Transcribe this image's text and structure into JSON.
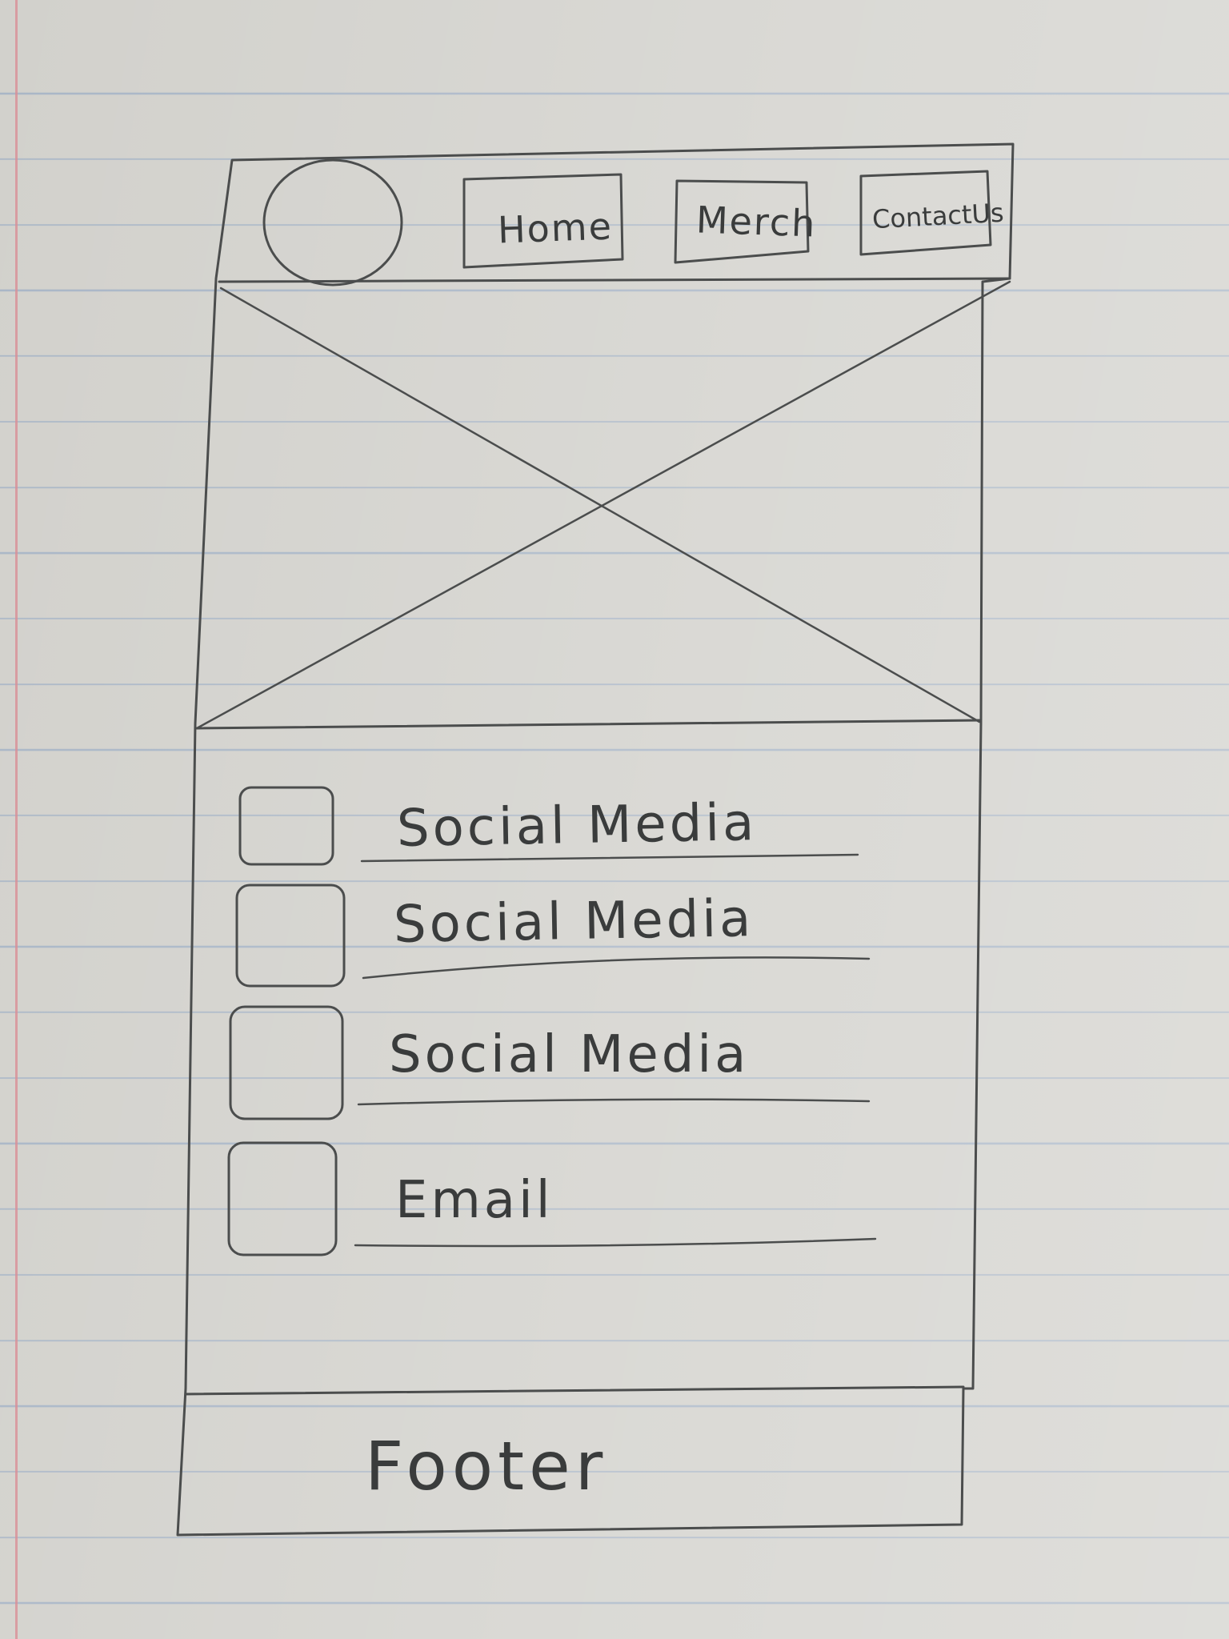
{
  "nav": {
    "logo_icon": "circle-logo-icon",
    "items": [
      {
        "label": "Home"
      },
      {
        "label": "Merch"
      },
      {
        "label": "ContactUs"
      }
    ]
  },
  "hero": {
    "icon": "image-placeholder-icon"
  },
  "links": [
    {
      "label": "Social Media",
      "icon": "square-icon"
    },
    {
      "label": "Social Media",
      "icon": "square-icon"
    },
    {
      "label": "Social Media",
      "icon": "square-icon"
    },
    {
      "label": "Email",
      "icon": "square-icon"
    }
  ],
  "footer": {
    "label": "Footer"
  },
  "colors": {
    "paper": "#d2d1cc",
    "rule": "#a9b6c6",
    "margin": "#d98f96",
    "pencil": "#4b4d4d"
  }
}
